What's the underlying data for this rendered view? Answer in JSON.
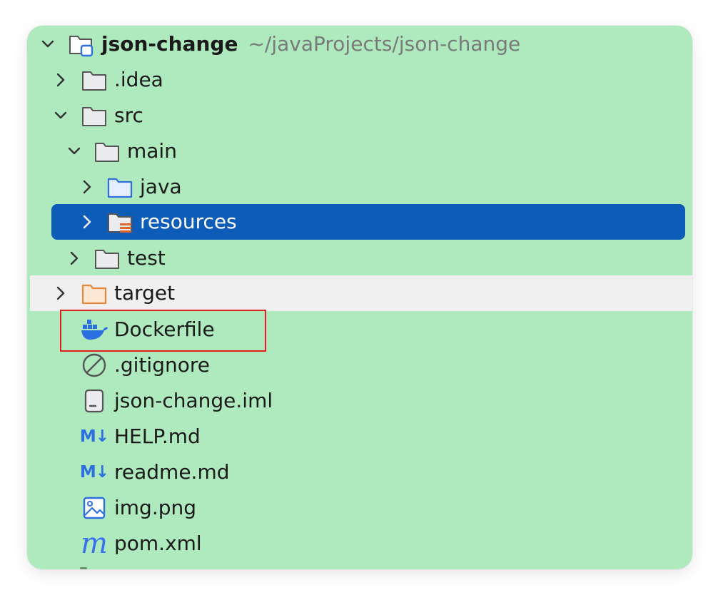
{
  "tree": {
    "root": {
      "name": "json-change",
      "path": "~/javaProjects/json-change"
    },
    "items": [
      {
        "label": ".idea"
      },
      {
        "label": "src"
      },
      {
        "label": "main"
      },
      {
        "label": "java"
      },
      {
        "label": "resources"
      },
      {
        "label": "test"
      },
      {
        "label": "target"
      },
      {
        "label": "Dockerfile"
      },
      {
        "label": ".gitignore"
      },
      {
        "label": "json-change.iml"
      },
      {
        "label": "HELP.md"
      },
      {
        "label": "readme.md"
      },
      {
        "label": "img.png"
      },
      {
        "label": "pom.xml"
      }
    ]
  },
  "icons": {
    "md_text": "M↓",
    "maven_text": "m"
  },
  "colors": {
    "panel_bg": "#aeeabe",
    "selection": "#0d5db8",
    "hover": "#f0f0f0",
    "annotation": "#e02020"
  }
}
